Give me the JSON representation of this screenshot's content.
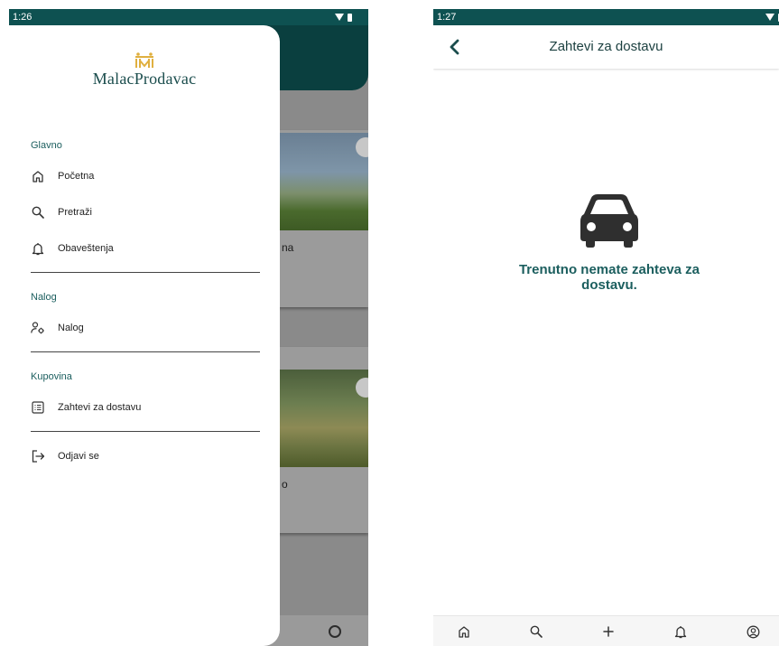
{
  "left_screen": {
    "status_time": "1:26",
    "brand": "MalacProdavac",
    "sections": [
      {
        "title": "Glavno",
        "items": [
          {
            "label": "Početna",
            "icon": "home-icon"
          },
          {
            "label": "Pretraži",
            "icon": "search-icon"
          },
          {
            "label": "Obaveštenja",
            "icon": "bell-icon"
          }
        ]
      },
      {
        "title": "Nalog",
        "items": [
          {
            "label": "Nalog",
            "icon": "account-settings-icon"
          }
        ]
      },
      {
        "title": "Kupovina",
        "items": [
          {
            "label": "Zahtevi za dostavu",
            "icon": "list-icon"
          }
        ]
      }
    ],
    "logout": {
      "label": "Odjavi se",
      "icon": "logout-icon"
    },
    "background": {
      "card1_snippet": "na",
      "card2_snippet": "o"
    }
  },
  "right_screen": {
    "status_time": "1:27",
    "title": "Zahtevi za dostavu",
    "empty_message": "Trenutno nemate zahteva za dostavu.",
    "empty_icon": "car-icon",
    "bottom_nav": [
      "home-icon",
      "search-icon",
      "plus-icon",
      "bell-icon",
      "profile-icon"
    ]
  },
  "colors": {
    "primary": "#0e5151",
    "accent_text": "#1b5e5e",
    "brand_gold": "#e0b040"
  }
}
